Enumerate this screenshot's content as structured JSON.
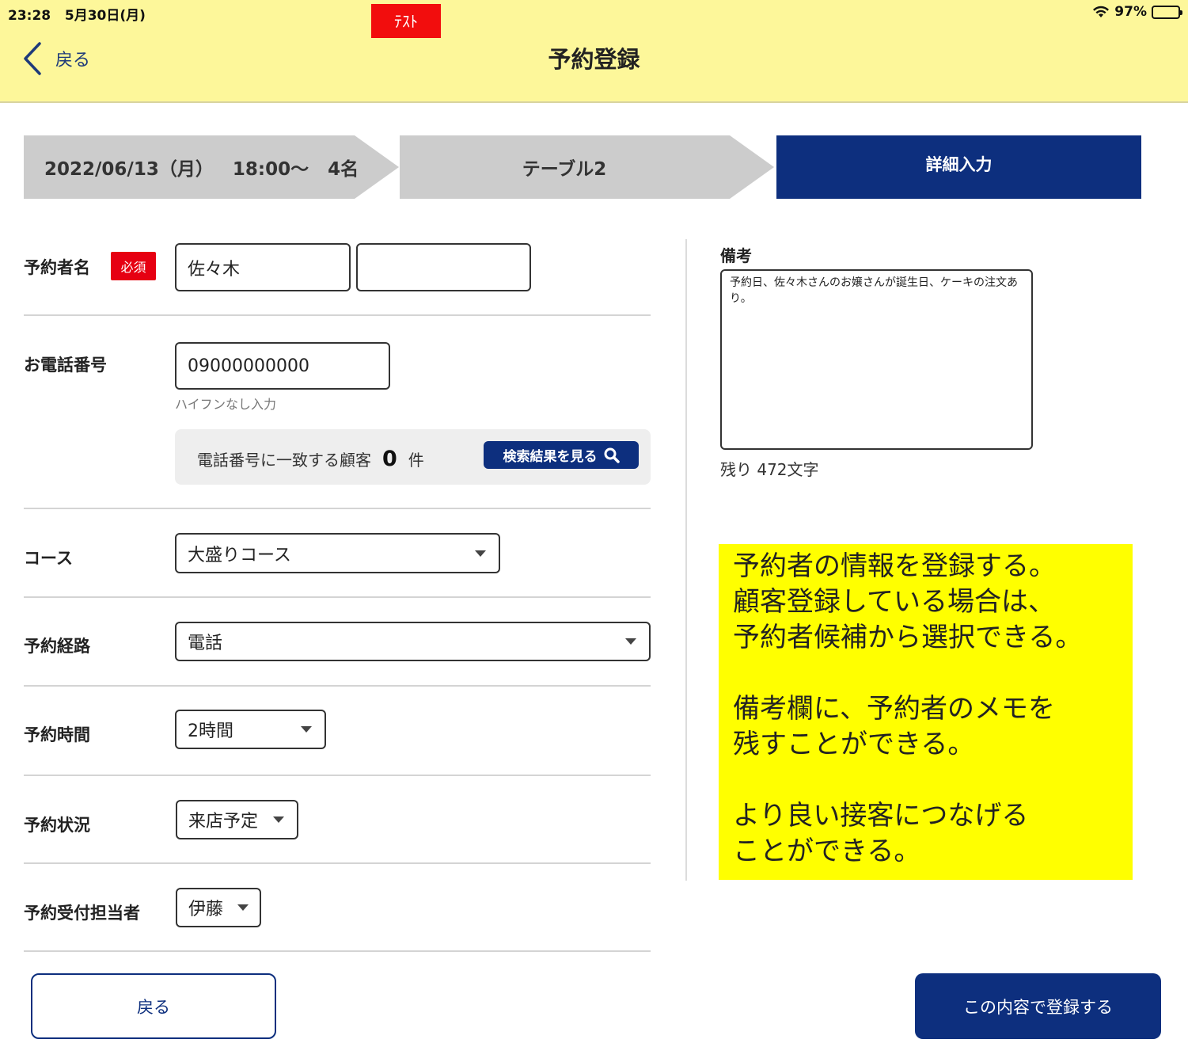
{
  "status_bar": {
    "time": "23:28",
    "date": "5月30日(月)",
    "battery": "97%",
    "wifi_icon": "wifi-icon",
    "battery_level": 0.97
  },
  "test_badge": "ﾃｽﾄ",
  "header": {
    "back_label": "戻る",
    "title": "予約登録"
  },
  "steps": [
    {
      "date": "2022/06/13（月）",
      "time": "18:00〜",
      "people": "4名"
    },
    {
      "label": "テーブル2"
    },
    {
      "label": "詳細入力",
      "active": true
    }
  ],
  "form": {
    "name": {
      "label": "予約者名",
      "required_badge": "必須",
      "last_name": "佐々木",
      "first_name": ""
    },
    "phone": {
      "label": "お電話番号",
      "value": "09000000000",
      "hint": "ハイフンなし入力"
    },
    "match": {
      "prefix": "電話番号に一致する顧客",
      "count": "0",
      "suffix": "件",
      "button_label": "検索結果を見る"
    },
    "course": {
      "label": "コース",
      "value": "大盛りコース"
    },
    "route": {
      "label": "予約経路",
      "value": "電話"
    },
    "duration": {
      "label": "予約時間",
      "value": "2時間"
    },
    "status": {
      "label": "予約状況",
      "value": "来店予定"
    },
    "staff": {
      "label": "予約受付担当者",
      "value": "伊藤"
    }
  },
  "notes": {
    "label": "備考",
    "value": "予約日、佐々木さんのお嬢さんが誕生日、ケーキの注文あり。",
    "remaining": "残り 472文字"
  },
  "annotation": {
    "line1": "予約者の情報を登録する。",
    "line2": "顧客登録している場合は、",
    "line3": "予約者候補から選択できる。",
    "line4": "備考欄に、予約者のメモを",
    "line5": "残すことができる。",
    "line6": "より良い接客につなげる",
    "line7": "ことができる。"
  },
  "buttons": {
    "back": "戻る",
    "submit": "この内容で登録する"
  },
  "colors": {
    "header_bg": "#fdf79a",
    "primary": "#0d2f7e",
    "required": "#e60012",
    "annotation_bg": "#ffff00",
    "step_inactive": "#cccccc"
  }
}
